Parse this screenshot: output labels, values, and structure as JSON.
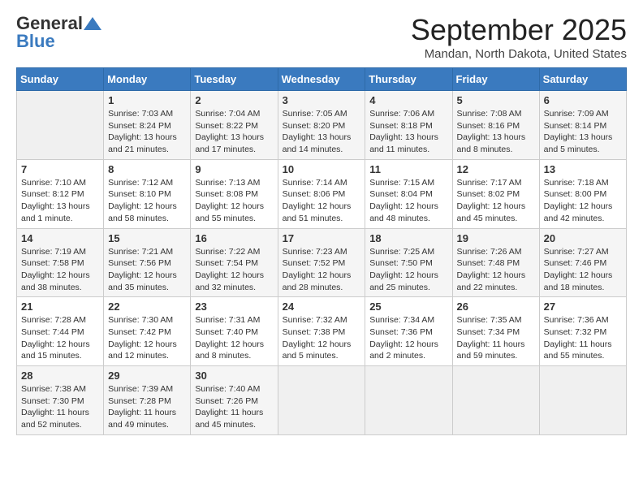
{
  "header": {
    "logo_general": "General",
    "logo_blue": "Blue",
    "month_title": "September 2025",
    "location": "Mandan, North Dakota, United States"
  },
  "days_of_week": [
    "Sunday",
    "Monday",
    "Tuesday",
    "Wednesday",
    "Thursday",
    "Friday",
    "Saturday"
  ],
  "weeks": [
    [
      {
        "day": "",
        "content": ""
      },
      {
        "day": "1",
        "content": "Sunrise: 7:03 AM\nSunset: 8:24 PM\nDaylight: 13 hours and 21 minutes."
      },
      {
        "day": "2",
        "content": "Sunrise: 7:04 AM\nSunset: 8:22 PM\nDaylight: 13 hours and 17 minutes."
      },
      {
        "day": "3",
        "content": "Sunrise: 7:05 AM\nSunset: 8:20 PM\nDaylight: 13 hours and 14 minutes."
      },
      {
        "day": "4",
        "content": "Sunrise: 7:06 AM\nSunset: 8:18 PM\nDaylight: 13 hours and 11 minutes."
      },
      {
        "day": "5",
        "content": "Sunrise: 7:08 AM\nSunset: 8:16 PM\nDaylight: 13 hours and 8 minutes."
      },
      {
        "day": "6",
        "content": "Sunrise: 7:09 AM\nSunset: 8:14 PM\nDaylight: 13 hours and 5 minutes."
      }
    ],
    [
      {
        "day": "7",
        "content": "Sunrise: 7:10 AM\nSunset: 8:12 PM\nDaylight: 13 hours and 1 minute."
      },
      {
        "day": "8",
        "content": "Sunrise: 7:12 AM\nSunset: 8:10 PM\nDaylight: 12 hours and 58 minutes."
      },
      {
        "day": "9",
        "content": "Sunrise: 7:13 AM\nSunset: 8:08 PM\nDaylight: 12 hours and 55 minutes."
      },
      {
        "day": "10",
        "content": "Sunrise: 7:14 AM\nSunset: 8:06 PM\nDaylight: 12 hours and 51 minutes."
      },
      {
        "day": "11",
        "content": "Sunrise: 7:15 AM\nSunset: 8:04 PM\nDaylight: 12 hours and 48 minutes."
      },
      {
        "day": "12",
        "content": "Sunrise: 7:17 AM\nSunset: 8:02 PM\nDaylight: 12 hours and 45 minutes."
      },
      {
        "day": "13",
        "content": "Sunrise: 7:18 AM\nSunset: 8:00 PM\nDaylight: 12 hours and 42 minutes."
      }
    ],
    [
      {
        "day": "14",
        "content": "Sunrise: 7:19 AM\nSunset: 7:58 PM\nDaylight: 12 hours and 38 minutes."
      },
      {
        "day": "15",
        "content": "Sunrise: 7:21 AM\nSunset: 7:56 PM\nDaylight: 12 hours and 35 minutes."
      },
      {
        "day": "16",
        "content": "Sunrise: 7:22 AM\nSunset: 7:54 PM\nDaylight: 12 hours and 32 minutes."
      },
      {
        "day": "17",
        "content": "Sunrise: 7:23 AM\nSunset: 7:52 PM\nDaylight: 12 hours and 28 minutes."
      },
      {
        "day": "18",
        "content": "Sunrise: 7:25 AM\nSunset: 7:50 PM\nDaylight: 12 hours and 25 minutes."
      },
      {
        "day": "19",
        "content": "Sunrise: 7:26 AM\nSunset: 7:48 PM\nDaylight: 12 hours and 22 minutes."
      },
      {
        "day": "20",
        "content": "Sunrise: 7:27 AM\nSunset: 7:46 PM\nDaylight: 12 hours and 18 minutes."
      }
    ],
    [
      {
        "day": "21",
        "content": "Sunrise: 7:28 AM\nSunset: 7:44 PM\nDaylight: 12 hours and 15 minutes."
      },
      {
        "day": "22",
        "content": "Sunrise: 7:30 AM\nSunset: 7:42 PM\nDaylight: 12 hours and 12 minutes."
      },
      {
        "day": "23",
        "content": "Sunrise: 7:31 AM\nSunset: 7:40 PM\nDaylight: 12 hours and 8 minutes."
      },
      {
        "day": "24",
        "content": "Sunrise: 7:32 AM\nSunset: 7:38 PM\nDaylight: 12 hours and 5 minutes."
      },
      {
        "day": "25",
        "content": "Sunrise: 7:34 AM\nSunset: 7:36 PM\nDaylight: 12 hours and 2 minutes."
      },
      {
        "day": "26",
        "content": "Sunrise: 7:35 AM\nSunset: 7:34 PM\nDaylight: 11 hours and 59 minutes."
      },
      {
        "day": "27",
        "content": "Sunrise: 7:36 AM\nSunset: 7:32 PM\nDaylight: 11 hours and 55 minutes."
      }
    ],
    [
      {
        "day": "28",
        "content": "Sunrise: 7:38 AM\nSunset: 7:30 PM\nDaylight: 11 hours and 52 minutes."
      },
      {
        "day": "29",
        "content": "Sunrise: 7:39 AM\nSunset: 7:28 PM\nDaylight: 11 hours and 49 minutes."
      },
      {
        "day": "30",
        "content": "Sunrise: 7:40 AM\nSunset: 7:26 PM\nDaylight: 11 hours and 45 minutes."
      },
      {
        "day": "",
        "content": ""
      },
      {
        "day": "",
        "content": ""
      },
      {
        "day": "",
        "content": ""
      },
      {
        "day": "",
        "content": ""
      }
    ]
  ]
}
